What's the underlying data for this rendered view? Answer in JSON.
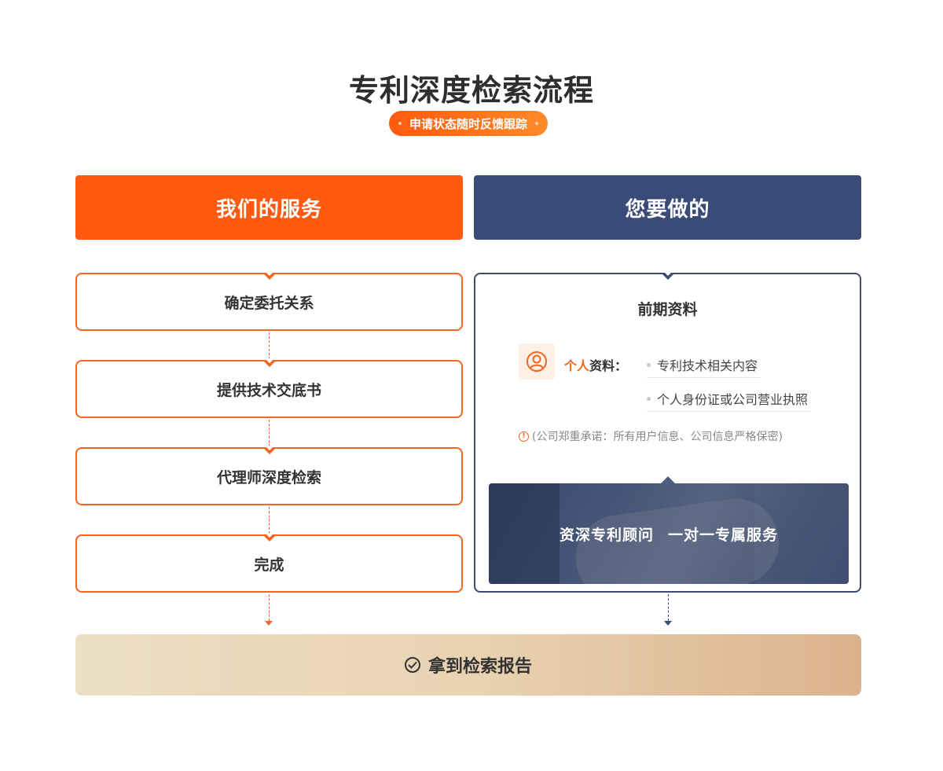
{
  "header": {
    "title": "专利深度检索流程",
    "subtitle": "申请状态随时反馈跟踪"
  },
  "columns": {
    "left_title": "我们的服务",
    "right_title": "您要做的"
  },
  "steps": [
    "确定委托关系",
    "提供技术交底书",
    "代理师深度检索",
    "完成"
  ],
  "prep": {
    "title": "前期资料",
    "label_accent": "个人",
    "label_rest": "资料：",
    "items": [
      "专利技术相关内容",
      "个人身份证或公司营业执照"
    ],
    "note": "(公司郑重承诺：所有用户信息、公司信息严格保密)",
    "banner_left": "资深专利顾问",
    "banner_right": "一对一专属服务"
  },
  "result": {
    "label": "拿到检索报告"
  },
  "colors": {
    "orange": "#ff5a0f",
    "navy": "#3a4b78"
  }
}
